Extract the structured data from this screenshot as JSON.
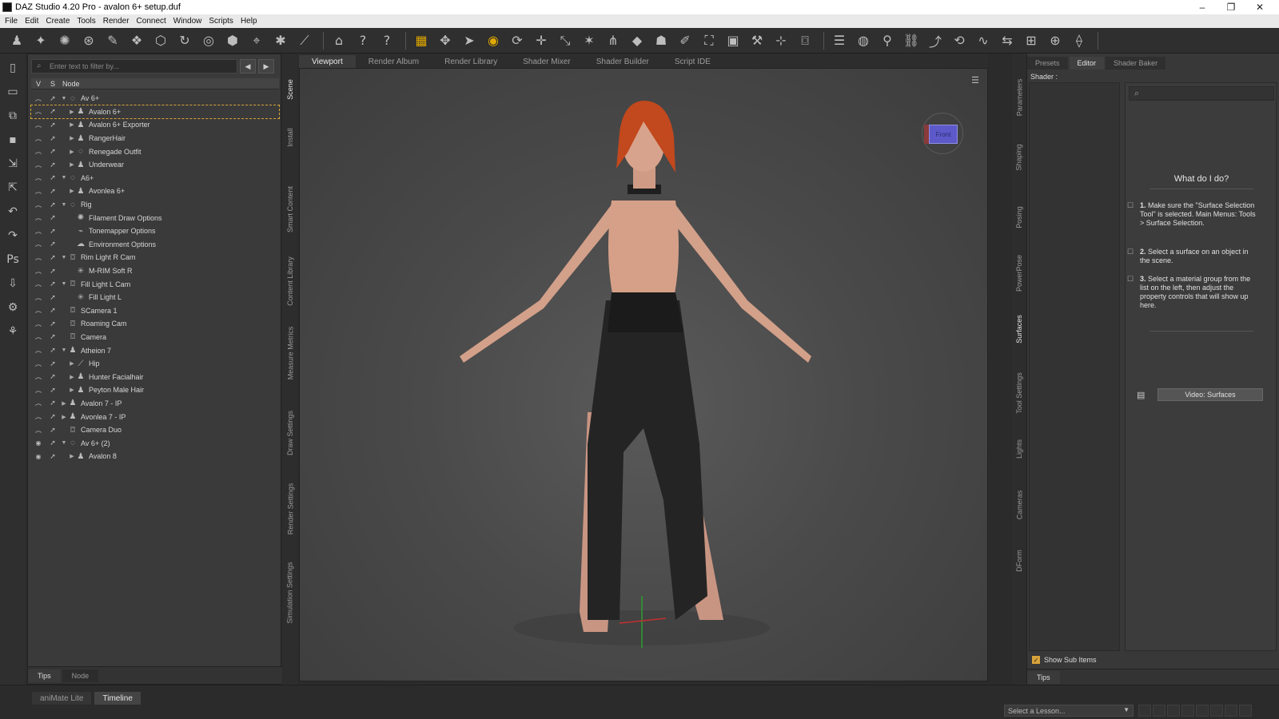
{
  "window": {
    "title": "DAZ Studio 4.20 Pro - avalon 6+ setup.duf",
    "controls": [
      "–",
      "❐",
      "✕"
    ]
  },
  "menu": [
    "File",
    "Edit",
    "Create",
    "Tools",
    "Render",
    "Connect",
    "Window",
    "Scripts",
    "Help"
  ],
  "toolbar_icons": [
    "figure-icon",
    "joint-icon",
    "weight-icon",
    "node-weight-icon",
    "brush-icon",
    "smoothing-icon",
    "geometry-icon",
    "rotate-icon",
    "pin-icon",
    "morph-icon",
    "region-icon",
    "spot-icon",
    "bone-icon",
    "home-icon",
    "whats-this-icon",
    "help-icon",
    "select-region-icon",
    "universal-icon",
    "pointer-icon",
    "surface-selection-icon",
    "rotate-tool-icon",
    "translate-icon",
    "scale-icon",
    "joint-editor-icon",
    "node-icon",
    "geometry-tool-icon",
    "morph-tool-icon",
    "brush-tool-icon",
    "groups-icon",
    "image-icon",
    "tools-icon",
    "picker-icon",
    "camera-icon",
    "align-icon",
    "spot-render-icon",
    "pose-icon",
    "link-icon",
    "bend-icon",
    "twist-icon",
    "lasso-icon",
    "flip-icon",
    "grid-icon",
    "globe-icon",
    "joint-toggle-icon"
  ],
  "left_rail_icons": [
    "new-icon",
    "open-icon",
    "merge-icon",
    "save-icon",
    "import-icon",
    "export-icon",
    "undo-icon",
    "redo-icon",
    "photoshop-icon",
    "download-icon",
    "figure-tool-icon",
    "pose-figure-icon"
  ],
  "scene": {
    "filter_placeholder": "Enter text to filter by...",
    "headers": {
      "v": "V",
      "s": "S",
      "node": "Node"
    },
    "nodes": [
      {
        "label": "Av 6+",
        "indent": 0,
        "arrow": "▼",
        "type": "group-icon"
      },
      {
        "label": "Avalon 6+",
        "indent": 1,
        "arrow": "▶",
        "type": "figure-icon",
        "selected": true
      },
      {
        "label": "Avalon 6+ Exporter",
        "indent": 1,
        "arrow": "▶",
        "type": "figure-icon"
      },
      {
        "label": "RangerHair",
        "indent": 1,
        "arrow": "▶",
        "type": "figure-icon"
      },
      {
        "label": "Renegade Outfit",
        "indent": 1,
        "arrow": "▶",
        "type": "group-icon"
      },
      {
        "label": "Underwear",
        "indent": 1,
        "arrow": "▶",
        "type": "figure-icon"
      },
      {
        "label": "A6+",
        "indent": 0,
        "arrow": "▼",
        "type": "group-icon"
      },
      {
        "label": "Avonlea 6+",
        "indent": 1,
        "arrow": "▶",
        "type": "figure-icon"
      },
      {
        "label": "Rig",
        "indent": 0,
        "arrow": "▼",
        "type": "group-icon"
      },
      {
        "label": "Filament Draw Options",
        "indent": 1,
        "arrow": "",
        "type": "options-icon"
      },
      {
        "label": "Tonemapper Options",
        "indent": 1,
        "arrow": "",
        "type": "tonemapper-icon"
      },
      {
        "label": "Environment Options",
        "indent": 1,
        "arrow": "",
        "type": "environment-icon"
      },
      {
        "label": "Rim Light R Cam",
        "indent": 0,
        "arrow": "▼",
        "type": "camera-icon"
      },
      {
        "label": "M-RIM Soft R",
        "indent": 1,
        "arrow": "",
        "type": "light-icon"
      },
      {
        "label": "Fill Light L Cam",
        "indent": 0,
        "arrow": "▼",
        "type": "camera-icon"
      },
      {
        "label": "Fill Light L",
        "indent": 1,
        "arrow": "",
        "type": "light-icon"
      },
      {
        "label": "SCamera 1",
        "indent": 0,
        "arrow": "",
        "type": "camera-icon"
      },
      {
        "label": "Roaming Cam",
        "indent": 0,
        "arrow": "",
        "type": "camera-icon"
      },
      {
        "label": "Camera",
        "indent": 0,
        "arrow": "",
        "type": "camera-icon"
      },
      {
        "label": "Atheion 7",
        "indent": 0,
        "arrow": "▼",
        "type": "figure-icon"
      },
      {
        "label": "Hip",
        "indent": 1,
        "arrow": "▶",
        "type": "bone-icon"
      },
      {
        "label": "Hunter Facialhair",
        "indent": 1,
        "arrow": "▶",
        "type": "figure-icon"
      },
      {
        "label": "Peyton Male Hair",
        "indent": 1,
        "arrow": "▶",
        "type": "figure-icon"
      },
      {
        "label": "Avalon 7 - IP",
        "indent": 0,
        "arrow": "▶",
        "type": "figure-icon"
      },
      {
        "label": "Avonlea 7 - IP",
        "indent": 0,
        "arrow": "▶",
        "type": "figure-icon"
      },
      {
        "label": "Camera Duo",
        "indent": 0,
        "arrow": "",
        "type": "camera-icon"
      },
      {
        "label": "Av 6+ (2)",
        "indent": 0,
        "arrow": "▼",
        "type": "group-icon"
      },
      {
        "label": "Avalon 8",
        "indent": 1,
        "arrow": "▶",
        "type": "figure-icon"
      }
    ],
    "bottom_tabs": [
      "Tips",
      "Node"
    ]
  },
  "left_vtabs": [
    "Scene",
    "Install",
    "Smart Content",
    "Content Library",
    "Measure Metrics",
    "Draw Settings",
    "Render Settings",
    "Simulation Settings"
  ],
  "viewport_tabs": [
    "Viewport",
    "Render Album",
    "Render Library",
    "Shader Mixer",
    "Shader Builder",
    "Script IDE"
  ],
  "view_cube_label": "Front",
  "right_vtabs": [
    "Parameters",
    "Shaping",
    "Posing",
    "PowerPose",
    "Surfaces",
    "Tool Settings",
    "Lights",
    "Cameras",
    "DForm"
  ],
  "surfaces": {
    "tabs": [
      "Presets",
      "Editor",
      "Shader Baker"
    ],
    "shader_label": "Shader :",
    "what_title": "What do I do?",
    "steps": [
      {
        "num": "1.",
        "text": "Make sure the \"Surface Selection Tool\" is selected. Main Menus: Tools > Surface Selection."
      },
      {
        "num": "2.",
        "text": "Select a surface on an object in the scene."
      },
      {
        "num": "3.",
        "text": "Select a material group from the list on the left, then adjust the property controls that will show up here."
      }
    ],
    "video_button": "Video: Surfaces",
    "show_sub_items": "Show Sub Items",
    "bottom_tab": "Tips"
  },
  "bottom": {
    "tabs": [
      "aniMate Lite",
      "Timeline"
    ],
    "lesson_placeholder": "Select a Lesson..."
  },
  "colors": {
    "accent": "#d8a33a",
    "hair": "#c2481d",
    "skin": "#d6a088"
  }
}
